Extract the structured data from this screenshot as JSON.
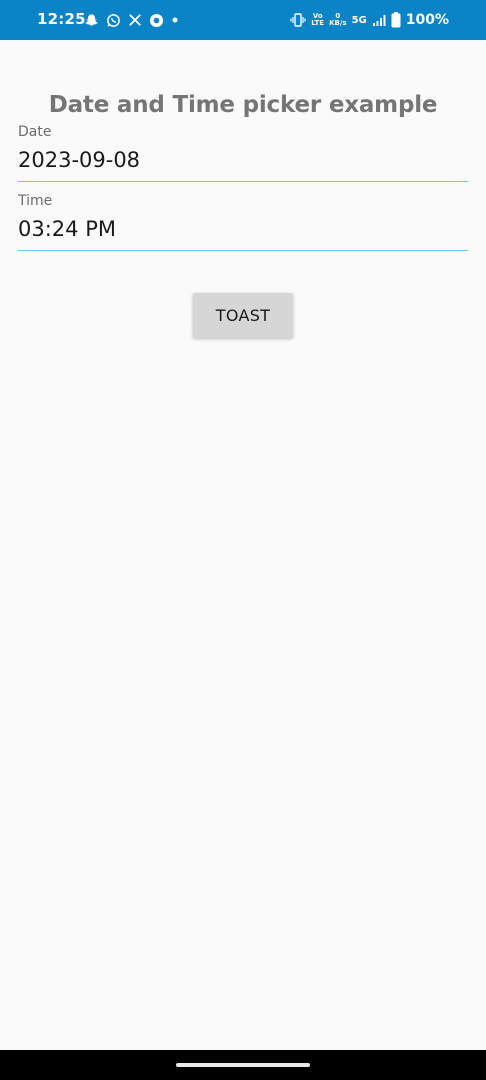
{
  "status_bar": {
    "time": "12:25",
    "left_icons": [
      "snapchat-icon",
      "whatsapp-icon",
      "x-icon",
      "app-icon",
      "dot-icon"
    ],
    "volte_top": "Vo",
    "volte_bottom": "LTE",
    "data_speed_value": "0",
    "data_speed_unit": "KB/s",
    "network": "5G",
    "battery": "100%",
    "colors": {
      "background": "#0a84c6",
      "foreground": "#ffffff"
    }
  },
  "main": {
    "title": "Date and Time picker example",
    "date_label": "Date",
    "date_value": "2023-09-08",
    "time_label": "Time",
    "time_value": "03:24 PM",
    "toast_button_label": "TOAST",
    "colors": {
      "underline": "#6ec6e8",
      "button_bg": "#d6d6d6",
      "title": "#757575"
    }
  }
}
